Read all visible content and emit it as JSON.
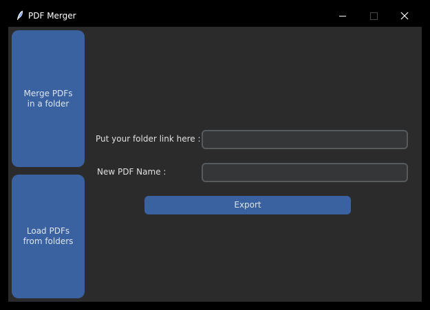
{
  "window": {
    "title": "PDF Merger",
    "icon": "feather-icon",
    "controls": [
      "minimize-icon",
      "maximize-icon",
      "close-icon"
    ]
  },
  "sidebar": {
    "items": [
      {
        "label": "Merge PDFs\nin a folder"
      },
      {
        "label": "Load PDFs\nfrom folders"
      }
    ]
  },
  "form": {
    "folder_label": "Put your folder link here :",
    "folder_value": "",
    "name_label": "New PDF Name :",
    "name_value": "",
    "export_label": "Export"
  },
  "colors": {
    "background": "#2b2b2b",
    "accent": "#3b62a0",
    "input_bg": "#343638",
    "input_border": "#565b5e",
    "titlebar": "#000000"
  }
}
